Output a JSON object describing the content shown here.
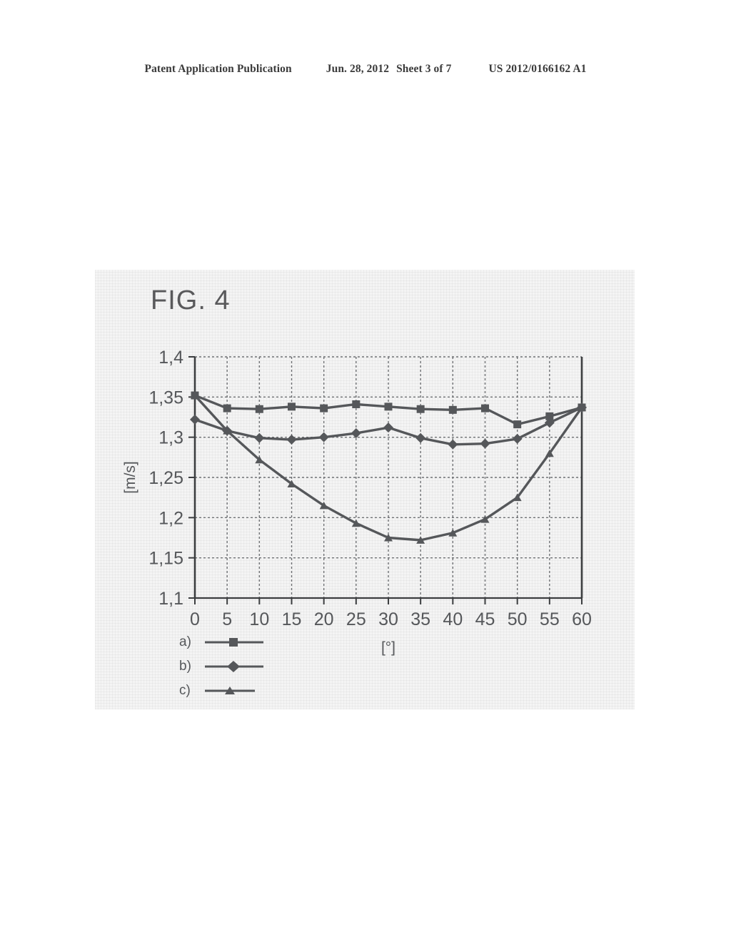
{
  "header": {
    "publication": "Patent Application Publication",
    "date": "Jun. 28, 2012",
    "sheet": "Sheet 3 of 7",
    "document_number": "US 2012/0166162 A1"
  },
  "figure": {
    "title": "FIG. 4"
  },
  "chart_data": {
    "type": "line",
    "title": "",
    "xlabel": "[°]",
    "ylabel": "[m/s]",
    "xlim": [
      0,
      60
    ],
    "ylim": [
      1.1,
      1.4
    ],
    "xticks": [
      0,
      5,
      10,
      15,
      20,
      25,
      30,
      35,
      40,
      45,
      50,
      55,
      60
    ],
    "xtick_labels": [
      "0",
      "5",
      "10",
      "15",
      "20",
      "25",
      "30",
      "35",
      "40",
      "45",
      "50",
      "55",
      "60"
    ],
    "yticks": [
      1.1,
      1.15,
      1.2,
      1.25,
      1.3,
      1.35,
      1.4
    ],
    "ytick_labels": [
      "1,1",
      "1,15",
      "1,2",
      "1,25",
      "1,3",
      "1,35",
      "1,4"
    ],
    "grid": true,
    "legend_position": "below-left",
    "x": [
      0,
      5,
      10,
      15,
      20,
      25,
      30,
      35,
      40,
      45,
      50,
      55,
      60
    ],
    "series": [
      {
        "name": "a)",
        "marker": "square",
        "values": [
          1.352,
          1.336,
          1.335,
          1.338,
          1.336,
          1.341,
          1.338,
          1.335,
          1.334,
          1.336,
          1.316,
          1.326,
          1.337
        ]
      },
      {
        "name": "b)",
        "marker": "diamond",
        "values": [
          1.322,
          1.308,
          1.299,
          1.297,
          1.3,
          1.305,
          1.312,
          1.299,
          1.291,
          1.292,
          1.298,
          1.318,
          1.337
        ]
      },
      {
        "name": "c)",
        "marker": "triangle",
        "values": [
          1.352,
          1.308,
          1.272,
          1.242,
          1.215,
          1.193,
          1.175,
          1.172,
          1.181,
          1.198,
          1.225,
          1.28,
          1.337
        ]
      }
    ],
    "line_color": "#55575a"
  },
  "legend": {
    "items": [
      {
        "label": "a)"
      },
      {
        "label": "b)"
      },
      {
        "label": "c)"
      }
    ]
  }
}
